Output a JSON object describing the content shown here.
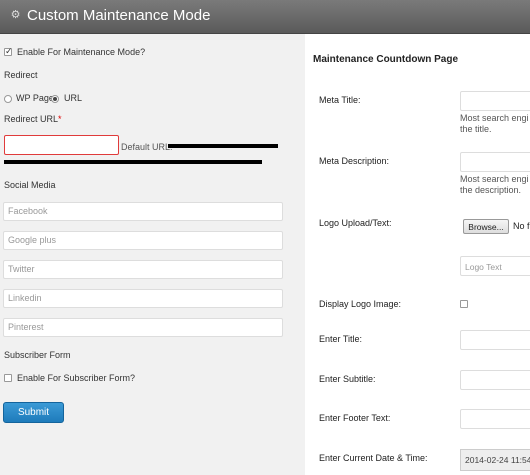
{
  "header": {
    "title": "Custom Maintenance Mode",
    "icon": "wp-settings-icon"
  },
  "left": {
    "enable_label": "Enable For Maintenance Mode?",
    "enable_checked": true,
    "redirect_label": "Redirect",
    "radio_wp_page": "WP Page",
    "radio_url": "URL",
    "redirect_url_label": "Redirect URL",
    "required_mark": "*",
    "default_url_label": "Default URL:",
    "social_media_label": "Social Media",
    "social": {
      "facebook": "Facebook",
      "google_plus": "Google plus",
      "twitter": "Twitter",
      "linkedin": "Linkedin",
      "pinterest": "Pinterest"
    },
    "subscriber_form_label": "Subscriber Form",
    "subscriber_enable_label": "Enable For Subscriber Form?",
    "submit_label": "Submit"
  },
  "right": {
    "heading": "Maintenance Countdown Page",
    "meta_title_label": "Meta Title:",
    "meta_title_help_1": "Most search engi",
    "meta_title_help_2": "the title.",
    "meta_description_label": "Meta Description:",
    "meta_description_help_1": "Most search engi",
    "meta_description_help_2": "the description.",
    "logo_upload_label": "Logo Upload/Text:",
    "browse_label": "Browse...",
    "no_file_text": "No f",
    "logo_text_placeholder": "Logo Text",
    "display_logo_label": "Display Logo Image:",
    "enter_title_label": "Enter Title:",
    "enter_subtitle_label": "Enter Subtitle:",
    "enter_footer_label": "Enter Footer Text:",
    "current_date_label": "Enter Current Date & Time:",
    "current_date_value": "2014-02-24 11:54"
  },
  "colors": {
    "titlebar": "#666666",
    "accent": "#2a88c8",
    "required": "#dd0000"
  }
}
